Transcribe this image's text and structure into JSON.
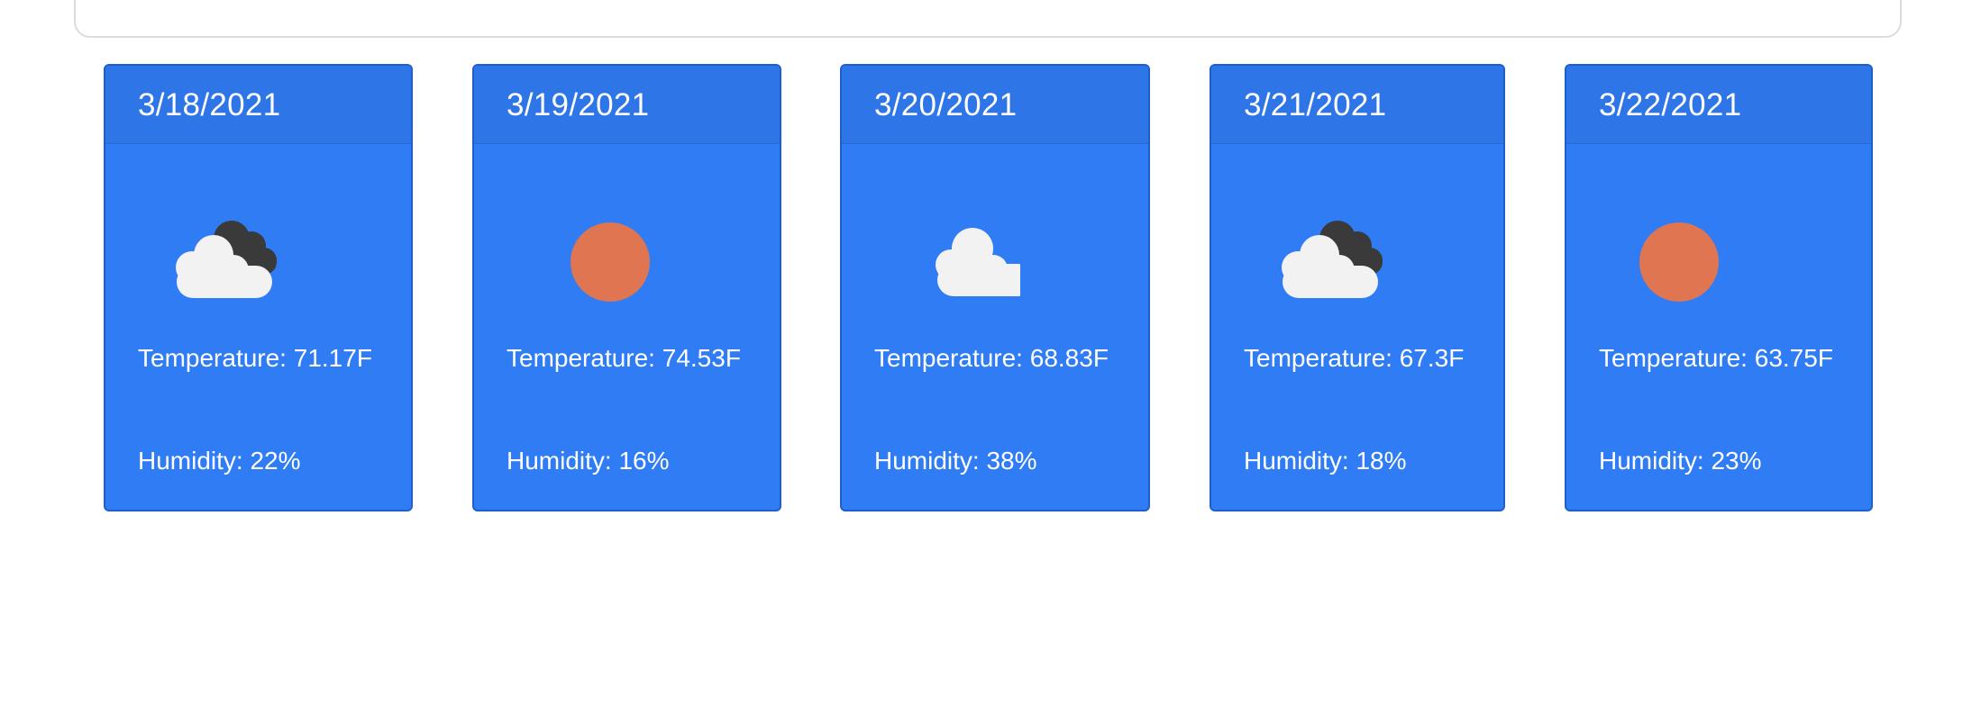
{
  "forecast": [
    {
      "date": "3/18/2021",
      "icon": "partly-cloudy-icon",
      "temperature": "Temperature: 71.17F",
      "humidity": "Humidity: 22%"
    },
    {
      "date": "3/19/2021",
      "icon": "sun-icon",
      "temperature": "Temperature: 74.53F",
      "humidity": "Humidity: 16%"
    },
    {
      "date": "3/20/2021",
      "icon": "cloud-icon",
      "temperature": "Temperature: 68.83F",
      "humidity": "Humidity: 38%"
    },
    {
      "date": "3/21/2021",
      "icon": "partly-cloudy-icon",
      "temperature": "Temperature: 67.3F",
      "humidity": "Humidity: 18%"
    },
    {
      "date": "3/22/2021",
      "icon": "sun-icon",
      "temperature": "Temperature: 63.75F",
      "humidity": "Humidity: 23%"
    }
  ],
  "colors": {
    "card_background": "#2f7cf5",
    "card_header": "#2e76e8",
    "sun": "#e07552",
    "cloud_light": "#f2f2f2",
    "cloud_dark": "#3a3a3a"
  }
}
